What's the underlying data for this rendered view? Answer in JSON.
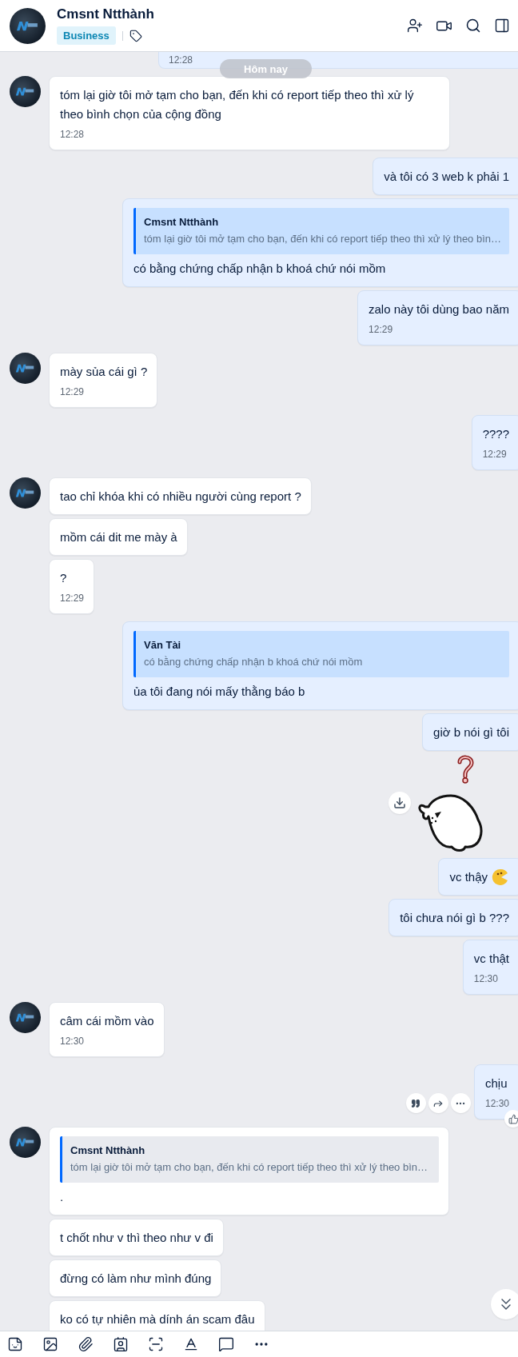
{
  "header": {
    "name": "Cmsnt Ntthành",
    "tag": "Business"
  },
  "date_divider": "Hôm nay",
  "messages": [
    {
      "kind": "fragment",
      "outgoing": true,
      "time": "12:28"
    },
    {
      "kind": "text",
      "outgoing": false,
      "avatar": true,
      "text": "tóm lại giờ tôi mở tạm cho bạn, đến khi có report tiếp theo thì xử lý theo bình chọn của cộng đồng",
      "time": "12:28"
    },
    {
      "kind": "text",
      "outgoing": true,
      "text": "và tôi có 3 web k phải 1"
    },
    {
      "kind": "quote",
      "outgoing": true,
      "quote_author": "Cmsnt Ntthành",
      "quote_text": "tóm lại giờ tôi mở tạm cho bạn, đến khi có report tiếp theo thì xử lý theo bìn…",
      "text": "có bằng chứng chấp nhận b khoá chứ nói mồm"
    },
    {
      "kind": "text",
      "outgoing": true,
      "text": "zalo này tôi dùng bao năm",
      "time": "12:29"
    },
    {
      "kind": "text",
      "outgoing": false,
      "avatar": true,
      "text": "mày sủa cái gì ?",
      "time": "12:29"
    },
    {
      "kind": "text",
      "outgoing": true,
      "text": "????",
      "time": "12:29"
    },
    {
      "kind": "text",
      "outgoing": false,
      "avatar": true,
      "text": "tao chỉ khóa khi có nhiều người cùng report ?"
    },
    {
      "kind": "text",
      "outgoing": false,
      "avatar": false,
      "text": "mồm cái dit me mày à"
    },
    {
      "kind": "text",
      "outgoing": false,
      "avatar": false,
      "text": "?",
      "time": "12:29"
    },
    {
      "kind": "quote",
      "outgoing": true,
      "quote_author": "Văn Tài",
      "quote_text": "có bằng chứng chấp nhận b khoá chứ nói mồm",
      "text": "ủa tôi đang nói mấy thằng báo b"
    },
    {
      "kind": "text",
      "outgoing": true,
      "text": "giờ b nói gì tôi"
    },
    {
      "kind": "sticker",
      "outgoing": true
    },
    {
      "kind": "text",
      "outgoing": true,
      "text": "vc thậy",
      "emoji": true
    },
    {
      "kind": "text",
      "outgoing": true,
      "text": "tôi chưa nói gì b ???"
    },
    {
      "kind": "text",
      "outgoing": true,
      "text": "vc thật",
      "time": "12:30"
    },
    {
      "kind": "text",
      "outgoing": false,
      "avatar": true,
      "text": "câm cái mồm vào",
      "time": "12:30"
    },
    {
      "kind": "text",
      "outgoing": true,
      "text": "chịu",
      "time": "12:30",
      "actions": true
    },
    {
      "kind": "quote",
      "outgoing": false,
      "avatar": true,
      "quote_author": "Cmsnt Ntthành",
      "quote_text": "tóm lại giờ tôi mở tạm cho bạn, đến khi có report tiếp theo thì xử lý theo bìn…",
      "text": "."
    },
    {
      "kind": "text",
      "outgoing": false,
      "avatar": false,
      "text": "t chốt như v thì theo như v đi"
    },
    {
      "kind": "text",
      "outgoing": false,
      "avatar": false,
      "text": "đừng có làm như mình đúng"
    },
    {
      "kind": "text",
      "outgoing": false,
      "avatar": false,
      "text": "ko có tự nhiên mà dính án scam đâu"
    }
  ]
}
